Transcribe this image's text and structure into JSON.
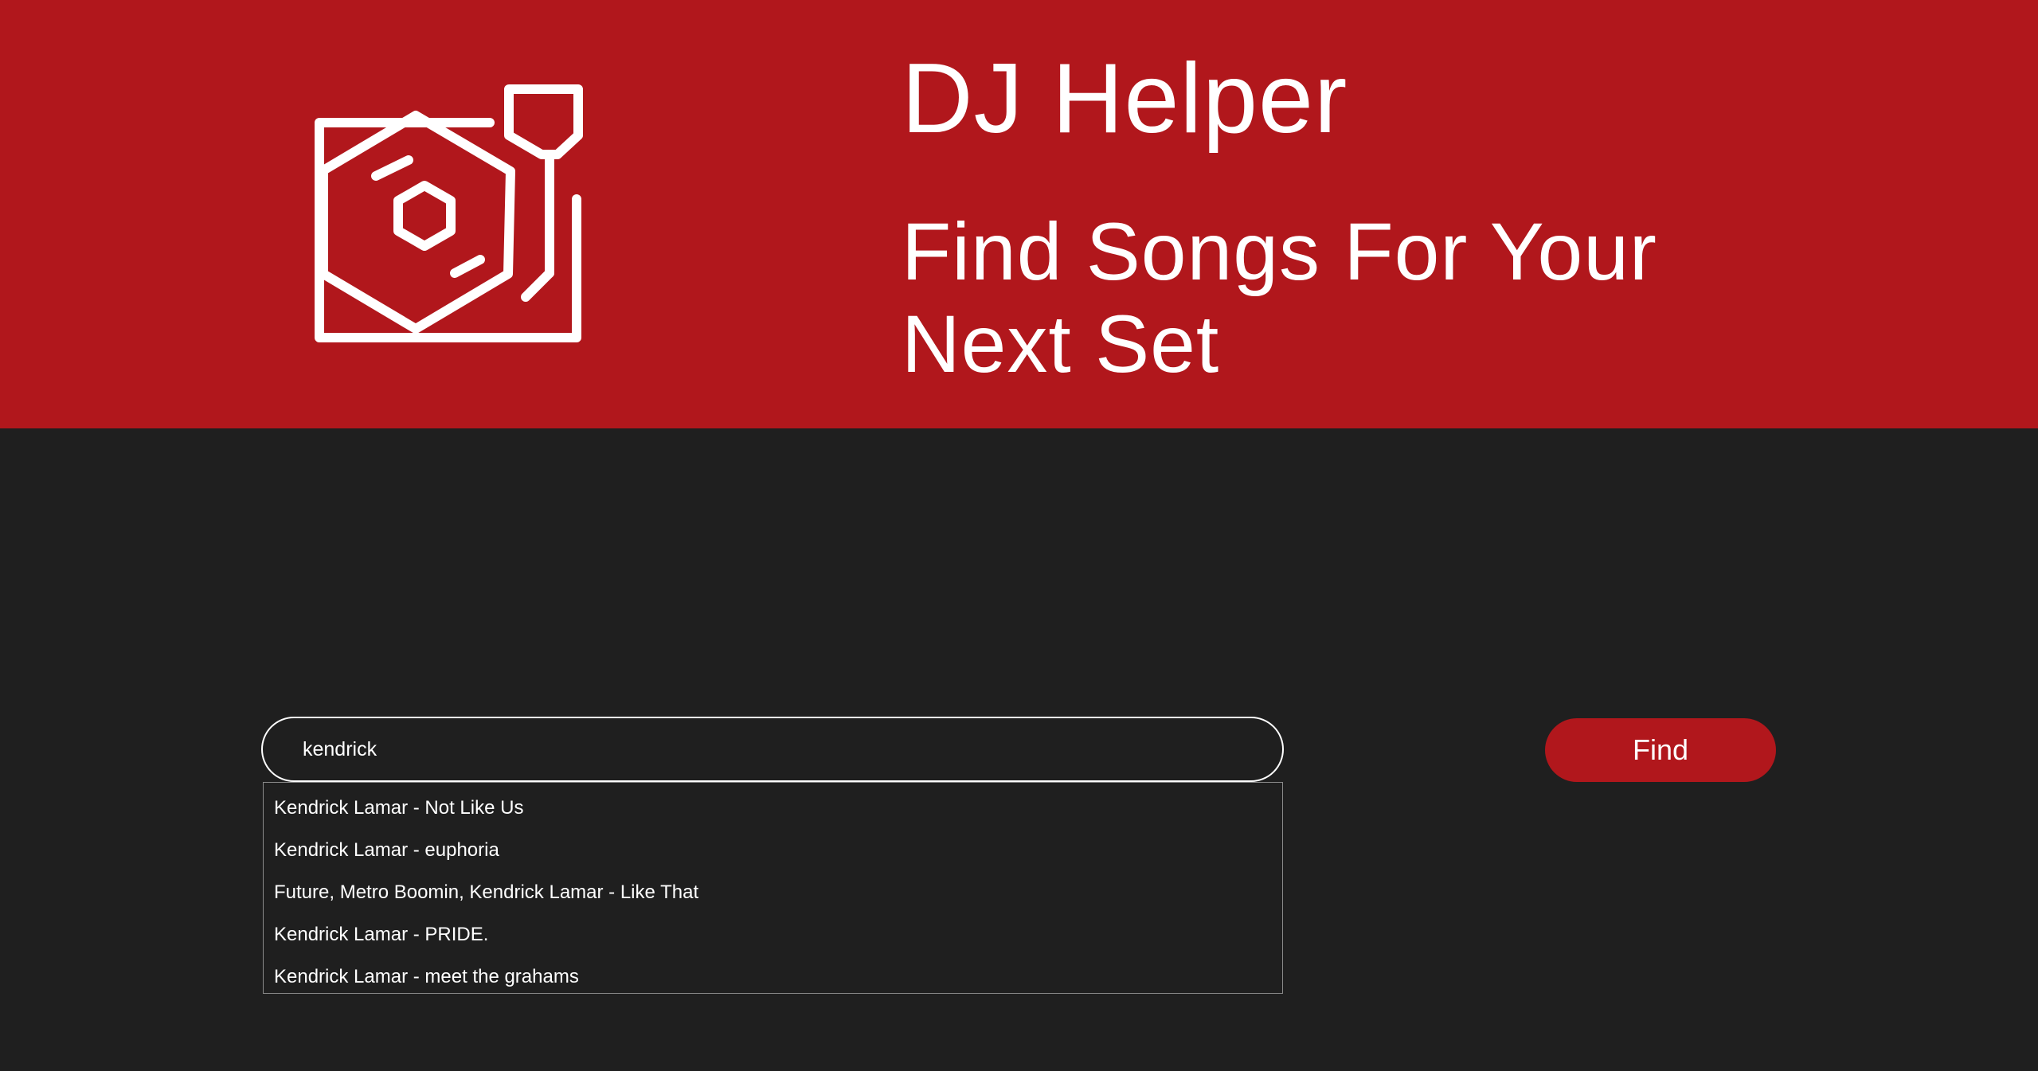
{
  "header": {
    "logo_icon": "turntable-icon",
    "title": "DJ Helper",
    "subtitle": "Find Songs For Your Next Set"
  },
  "search": {
    "value": "kendrick",
    "suggestions": [
      "Kendrick Lamar - Not Like Us",
      "Kendrick Lamar - euphoria",
      "Future, Metro Boomin, Kendrick Lamar - Like That",
      "Kendrick Lamar - PRIDE.",
      "Kendrick Lamar - meet the grahams"
    ],
    "button_label": "Find"
  },
  "colors": {
    "accent": "#b1171c",
    "background": "#1f1f1f",
    "text": "#ffffff"
  }
}
